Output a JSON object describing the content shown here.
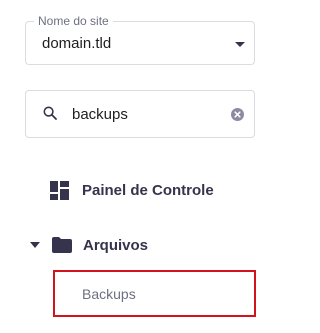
{
  "site_select": {
    "label": "Nome do site",
    "value": "domain.tld"
  },
  "search": {
    "value": "backups",
    "icon": "search-icon",
    "clear_icon": "clear-icon"
  },
  "nav": {
    "items": [
      {
        "label": "Painel de Controle",
        "icon": "dashboard-icon"
      },
      {
        "label": "Arquivos",
        "icon": "folder-icon",
        "expanded": true,
        "children": [
          {
            "label": "Backups",
            "highlighted": true
          }
        ]
      }
    ]
  },
  "colors": {
    "highlight_border": "#d0131c",
    "nav_text": "#36344d",
    "muted_text": "#6d7081",
    "border": "#dadce0"
  }
}
